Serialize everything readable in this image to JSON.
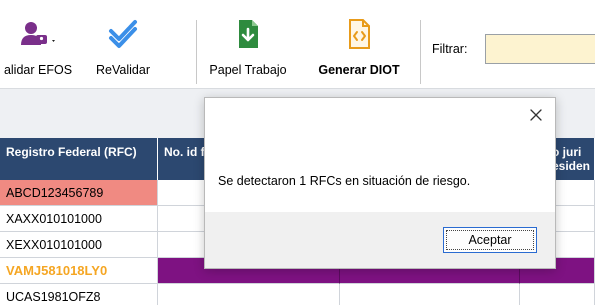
{
  "toolbar": {
    "buttons": [
      {
        "label": "alidar EFOS",
        "icon": "user-validate-icon"
      },
      {
        "label": "ReValidar",
        "icon": "checkmark-icon"
      },
      {
        "label": "Papel Trabajo",
        "icon": "download-document-icon"
      },
      {
        "label": "Generar DIOT",
        "icon": "code-document-icon"
      }
    ],
    "filter_label": "Filtrar:",
    "filter_value": ""
  },
  "grid": {
    "headers": [
      "Registro Federal (RFC)",
      "No. id fiscal",
      "",
      "o juri esiden"
    ],
    "rows": [
      {
        "rfc": "ABCD123456789",
        "status": "risk"
      },
      {
        "rfc": "XAXX010101000",
        "status": "normal"
      },
      {
        "rfc": "XEXX010101000",
        "status": "normal"
      },
      {
        "rfc": "VAMJ581018LY0",
        "status": "highlighted"
      },
      {
        "rfc": "UCAS1981OFZ8",
        "status": "normal"
      }
    ]
  },
  "dialog": {
    "message": "Se detectaron 1 RFCs en situación de riesgo.",
    "ok_label": "Aceptar"
  },
  "colors": {
    "header_bg": "#2c4870",
    "risk_cell": "#f08a82",
    "highlight_row": "#7e1282",
    "highlight_text": "#f5a623",
    "filter_bg": "#fdf3d0",
    "accent_blue": "#2a6bd1",
    "green_icon": "#2e8b3e",
    "orange_icon": "#e89b1a",
    "purple_icon": "#7a2f8a"
  }
}
